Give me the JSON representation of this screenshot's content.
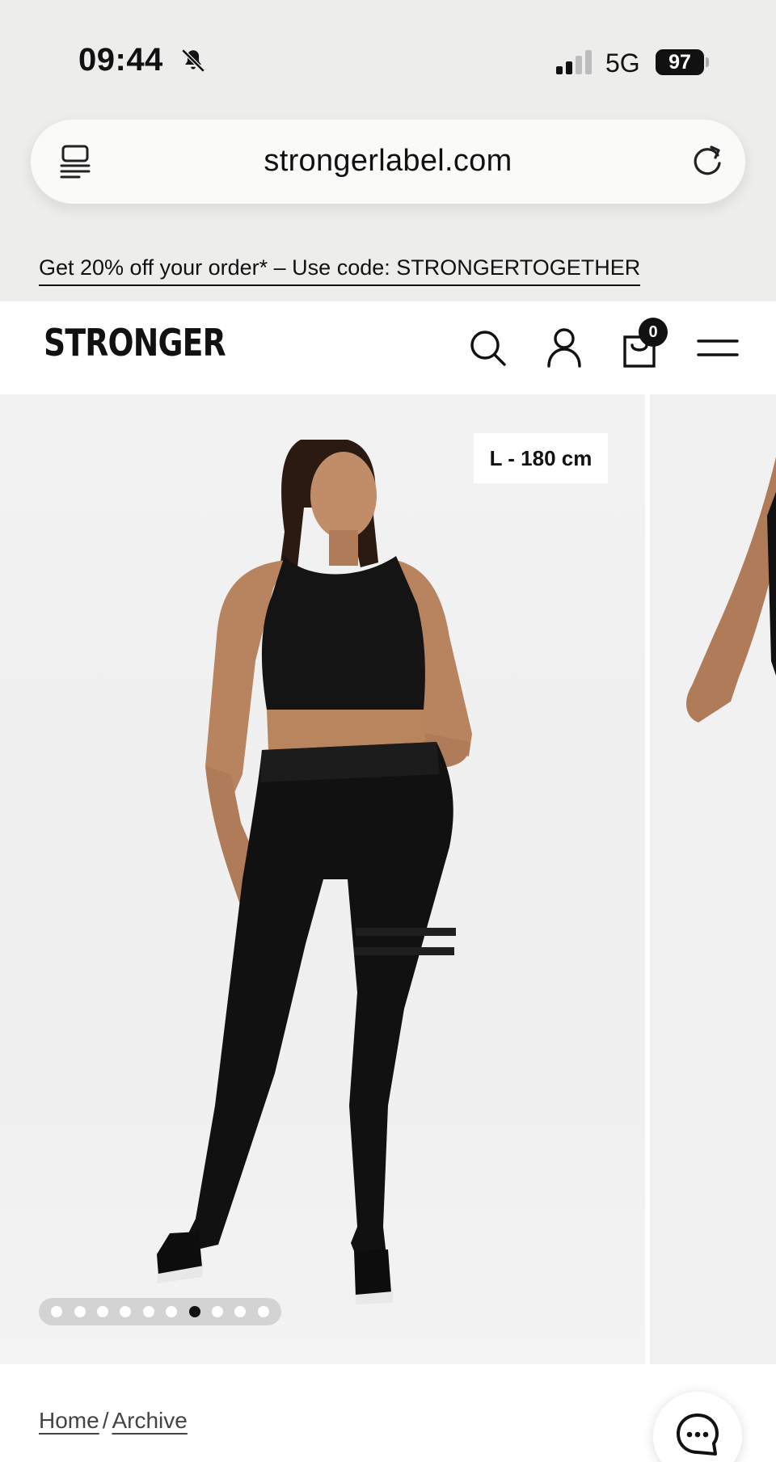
{
  "status_bar": {
    "time": "09:44",
    "network": "5G",
    "battery": "97"
  },
  "browser": {
    "url": "strongerlabel.com"
  },
  "promo": {
    "text": "Get 20% off your order* – Use code: STRONGERTOGETHER"
  },
  "header": {
    "logo": "STRONGER",
    "cart_count": "0"
  },
  "gallery": {
    "size_label": "L - 180 cm",
    "dot_count": 10,
    "active_dot": 6
  },
  "breadcrumb": {
    "home": "Home",
    "separator": "/",
    "current": "Archive"
  },
  "colors": {
    "accent": "#111111",
    "background": "#ededeb",
    "image_bg": "#f1f1f1"
  }
}
